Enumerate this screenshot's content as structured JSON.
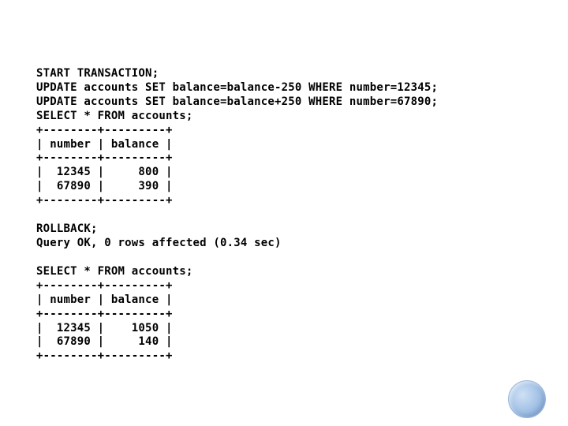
{
  "block1": "START TRANSACTION;\nUPDATE accounts SET balance=balance-250 WHERE number=12345;\nUPDATE accounts SET balance=balance+250 WHERE number=67890;\nSELECT * FROM accounts;\n+--------+---------+\n| number | balance |\n+--------+---------+\n|  12345 |     800 |\n|  67890 |     390 |\n+--------+---------+",
  "block2": "ROLLBACK;\nQuery OK, 0 rows affected (0.34 sec)",
  "block3": "SELECT * FROM accounts;\n+--------+---------+\n| number | balance |\n+--------+---------+\n|  12345 |    1050 |\n|  67890 |     140 |\n+--------+---------+"
}
